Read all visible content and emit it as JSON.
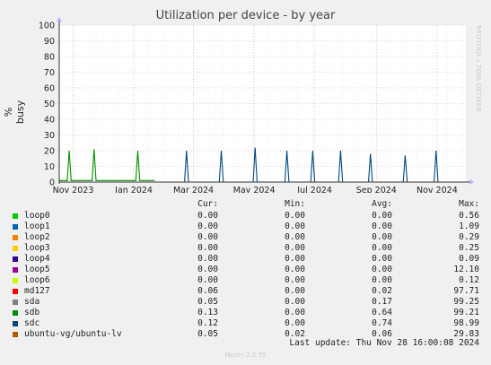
{
  "chart_data": {
    "type": "line",
    "title": "Utilization per device - by year",
    "ylabel": "% busy",
    "side_credit": "RRDTOOL / TOBI OETIKER",
    "ylim": [
      0,
      100
    ],
    "yticks": [
      0,
      10,
      20,
      30,
      40,
      50,
      60,
      70,
      80,
      90,
      100
    ],
    "xlim": [
      "2023-10-18",
      "2024-11-30"
    ],
    "xticks": [
      {
        "label": "Nov 2023",
        "date": "2023-11-01"
      },
      {
        "label": "Jan 2024",
        "date": "2024-01-01"
      },
      {
        "label": "Mar 2024",
        "date": "2024-03-01"
      },
      {
        "label": "May 2024",
        "date": "2024-05-01"
      },
      {
        "label": "Jul 2024",
        "date": "2024-07-01"
      },
      {
        "label": "Sep 2024",
        "date": "2024-09-01"
      },
      {
        "label": "Nov 2024",
        "date": "2024-11-01"
      }
    ],
    "grid": true,
    "series": [
      {
        "name": "loop0",
        "color": "#00cc00"
      },
      {
        "name": "loop1",
        "color": "#0066b3"
      },
      {
        "name": "loop2",
        "color": "#ff8000"
      },
      {
        "name": "loop3",
        "color": "#ffcc00"
      },
      {
        "name": "loop4",
        "color": "#330099"
      },
      {
        "name": "loop5",
        "color": "#990099"
      },
      {
        "name": "loop6",
        "color": "#ccff00"
      },
      {
        "name": "md127",
        "color": "#ff0000"
      },
      {
        "name": "sda",
        "color": "#808080"
      },
      {
        "name": "sdb",
        "color": "#008f00",
        "points": [
          [
            "2023-10-18",
            1
          ],
          [
            "2023-10-26",
            1
          ],
          [
            "2023-10-28",
            20
          ],
          [
            "2023-10-30",
            1
          ],
          [
            "2023-11-20",
            1
          ],
          [
            "2023-11-22",
            21
          ],
          [
            "2023-11-24",
            1
          ],
          [
            "2023-12-08",
            1
          ],
          [
            "2023-12-10",
            1
          ],
          [
            "2023-12-30",
            1
          ],
          [
            "2024-01-03",
            1
          ],
          [
            "2024-01-05",
            20
          ],
          [
            "2024-01-07",
            1
          ],
          [
            "2024-01-22",
            1
          ]
        ]
      },
      {
        "name": "sdc",
        "color": "#00487d",
        "points": [
          [
            "2024-02-21",
            0
          ],
          [
            "2024-02-23",
            20
          ],
          [
            "2024-02-25",
            0
          ],
          [
            "2024-03-27",
            0
          ],
          [
            "2024-03-29",
            20
          ],
          [
            "2024-03-31",
            0
          ],
          [
            "2024-04-30",
            0
          ],
          [
            "2024-05-02",
            22
          ],
          [
            "2024-05-04",
            0
          ],
          [
            "2024-06-01",
            0
          ],
          [
            "2024-06-03",
            20
          ],
          [
            "2024-06-05",
            0
          ],
          [
            "2024-06-27",
            0
          ],
          [
            "2024-06-29",
            20
          ],
          [
            "2024-07-01",
            0
          ],
          [
            "2024-07-25",
            0
          ],
          [
            "2024-07-27",
            20
          ],
          [
            "2024-07-29",
            0
          ],
          [
            "2024-08-24",
            0
          ],
          [
            "2024-08-26",
            18
          ],
          [
            "2024-08-28",
            0
          ],
          [
            "2024-09-28",
            0
          ],
          [
            "2024-09-30",
            17
          ],
          [
            "2024-10-02",
            0
          ],
          [
            "2024-10-29",
            0
          ],
          [
            "2024-10-31",
            20
          ],
          [
            "2024-11-02",
            0
          ]
        ]
      },
      {
        "name": "ubuntu-vg/ubuntu-lv",
        "color": "#b35a00"
      }
    ]
  },
  "legend": {
    "headers": {
      "cur": "Cur:",
      "min": "Min:",
      "avg": "Avg:",
      "max": "Max:"
    },
    "rows": [
      {
        "name": "loop0",
        "color": "#00cc00",
        "cur": "0.00",
        "min": "0.00",
        "avg": "0.00",
        "max": "0.56"
      },
      {
        "name": "loop1",
        "color": "#0066b3",
        "cur": "0.00",
        "min": "0.00",
        "avg": "0.00",
        "max": "1.09"
      },
      {
        "name": "loop2",
        "color": "#ff8000",
        "cur": "0.00",
        "min": "0.00",
        "avg": "0.00",
        "max": "0.29"
      },
      {
        "name": "loop3",
        "color": "#ffcc00",
        "cur": "0.00",
        "min": "0.00",
        "avg": "0.00",
        "max": "0.25"
      },
      {
        "name": "loop4",
        "color": "#330099",
        "cur": "0.00",
        "min": "0.00",
        "avg": "0.00",
        "max": "0.09"
      },
      {
        "name": "loop5",
        "color": "#990099",
        "cur": "0.00",
        "min": "0.00",
        "avg": "0.00",
        "max": "12.10"
      },
      {
        "name": "loop6",
        "color": "#ccff00",
        "cur": "0.00",
        "min": "0.00",
        "avg": "0.00",
        "max": "0.12"
      },
      {
        "name": "md127",
        "color": "#ff0000",
        "cur": "0.06",
        "min": "0.00",
        "avg": "0.02",
        "max": "97.71"
      },
      {
        "name": "sda",
        "color": "#808080",
        "cur": "0.05",
        "min": "0.00",
        "avg": "0.17",
        "max": "99.25"
      },
      {
        "name": "sdb",
        "color": "#008f00",
        "cur": "0.13",
        "min": "0.00",
        "avg": "0.64",
        "max": "99.21"
      },
      {
        "name": "sdc",
        "color": "#00487d",
        "cur": "0.12",
        "min": "0.00",
        "avg": "0.74",
        "max": "98.99"
      },
      {
        "name": "ubuntu-vg/ubuntu-lv",
        "color": "#b35a00",
        "cur": "0.05",
        "min": "0.02",
        "avg": "0.06",
        "max": "29.83"
      }
    ]
  },
  "last_update": "Last update: Thu Nov 28 16:00:08 2024",
  "version": "Munin 2.0.75"
}
